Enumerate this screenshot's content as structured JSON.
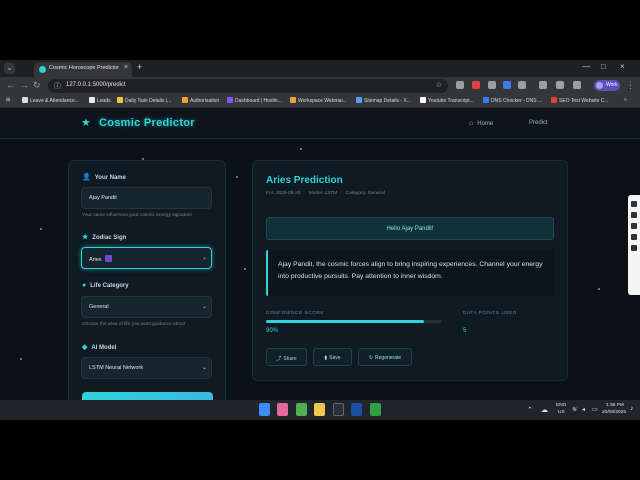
{
  "browser": {
    "tab_title": "Cosmic Horoscope Predictor",
    "tab_close": "×",
    "new_tab": "+",
    "url": "127.0.0.1:5000/predict",
    "profile_label": "Work",
    "window_controls": [
      "—",
      "□",
      "×"
    ]
  },
  "bookmarks": [
    {
      "label": "Leave & Attendance...",
      "color": "#dadce0"
    },
    {
      "label": "Leads",
      "color": "#e8eaed"
    },
    {
      "label": "Daily Task Details |...",
      "color": "#f5c542"
    },
    {
      "label": "Authorization",
      "color": "#f1a33b"
    },
    {
      "label": "Dashboard | Hostin...",
      "color": "#7b5cf0"
    },
    {
      "label": "Workspace Webmai...",
      "color": "#e8a33b"
    },
    {
      "label": "Sitemap Details - X...",
      "color": "#5aa0f0"
    },
    {
      "label": "Youtube Transcript...",
      "color": "#ffffff"
    },
    {
      "label": "DNS Checker - DNS ...",
      "color": "#3b7bf0"
    },
    {
      "label": "SEO Test Website C...",
      "color": "#e04040"
    }
  ],
  "nav": {
    "brand": "Cosmic Predictor",
    "brand_icon": "★",
    "home_icon": "⌂",
    "home": "Home",
    "predict": "Predict"
  },
  "form": {
    "name_label": "Your Name",
    "name_icon": "👤",
    "name_value": "Ajay Pandit",
    "name_help": "Your name influences your cosmic energy signature",
    "zodiac_label": "Zodiac Sign",
    "zodiac_icon": "★",
    "zodiac_value": "Aries",
    "category_label": "Life Category",
    "category_icon": "●",
    "category_value": "General",
    "category_help": "Choose the area of life you want guidance about",
    "model_label": "AI Model",
    "model_icon": "◆",
    "model_value": "LSTM Neural Network",
    "select_caret": "⌄"
  },
  "result": {
    "title": "Aries Prediction",
    "date": "For: 2025-08-20",
    "model": "Model: LSTM",
    "category": "Category: General",
    "greeting": "Hello Ajay Pandit!",
    "prediction": "Ajay Pandit, the cosmic forces align to bring inspiring experiences. Channel your energy into productive pursuits. Pay attention to inner wisdom.",
    "confidence_label": "CONFIDENCE SCORE",
    "confidence_value": "90%",
    "confidence_fraction": 0.9,
    "datapoints_label": "DATA POINTS USED",
    "datapoints_value": "5",
    "share": "Share",
    "save": "Save",
    "regenerate": "Regenerate"
  },
  "taskbar": {
    "lang_top": "ENG",
    "lang_bottom": "US",
    "time": "1:38 PM",
    "date": "20/08/2025"
  }
}
